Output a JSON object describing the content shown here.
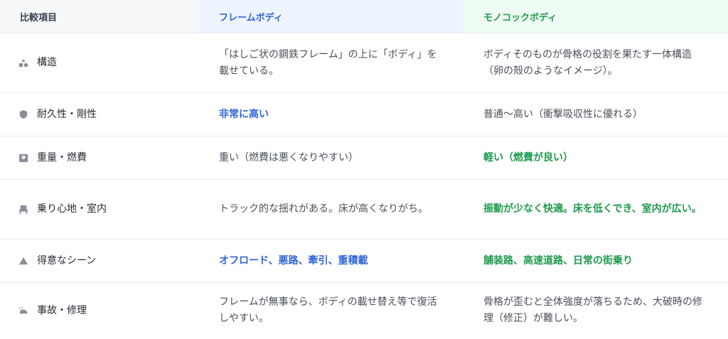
{
  "header": {
    "item": "比較項目",
    "frame": "フレームボディ",
    "mono": "モノコックボディ"
  },
  "rows": [
    {
      "label": "構造",
      "icon": "shapes-icon",
      "frame": "「はしご状の鋼鉄フレーム」の上に「ボディ」を載せている。",
      "frame_style": "plain",
      "mono": "ボディそのものが骨格の役割を果たす一体構造（卵の殻のようなイメージ）。",
      "mono_style": "plain"
    },
    {
      "label": "耐久性・剛性",
      "icon": "shield-icon",
      "frame": "非常に高い",
      "frame_style": "blue",
      "mono": "普通〜高い（衝撃吸収性に優れる）",
      "mono_style": "plain"
    },
    {
      "label": "重量・燃費",
      "icon": "scale-icon",
      "frame": "重い（燃費は悪くなりやすい）",
      "frame_style": "plain",
      "mono": "軽い（燃費が良い）",
      "mono_style": "green"
    },
    {
      "label": "乗り心地・室内",
      "icon": "seat-icon",
      "frame": "トラック的な揺れがある。床が高くなりがち。",
      "frame_style": "plain",
      "mono": "振動が少なく快適。床を低くでき、室内が広い。",
      "mono_style": "green"
    },
    {
      "label": "得意なシーン",
      "icon": "mountain-icon",
      "frame": "オフロード、悪路、牽引、重積載",
      "frame_style": "blue",
      "mono": "舗装路、高速道路、日常の街乗り",
      "mono_style": "green"
    },
    {
      "label": "事故・修理",
      "icon": "car-crash-icon",
      "frame": "フレームが無事なら、ボディの載せ替え等で復活しやすい。",
      "frame_style": "plain",
      "mono": "骨格が歪むと全体強度が落ちるため、大破時の修理（修正）が難しい。",
      "mono_style": "plain"
    }
  ]
}
